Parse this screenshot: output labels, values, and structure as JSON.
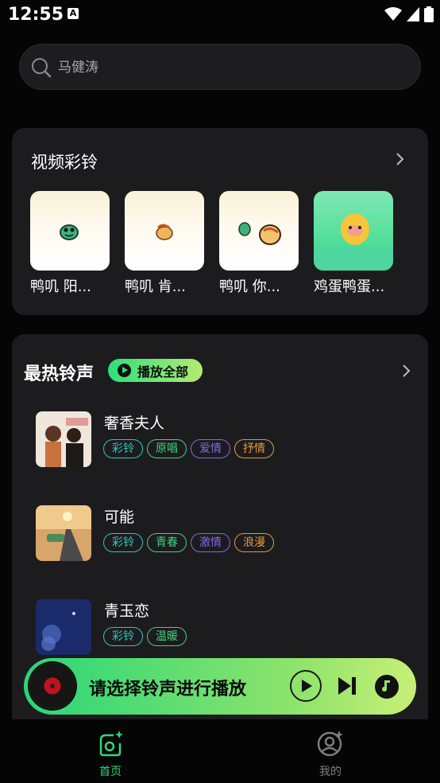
{
  "status_bar": {
    "time": "12:55",
    "notif_icon": "A"
  },
  "search": {
    "placeholder": "马健涛"
  },
  "video_section": {
    "title": "视频彩铃",
    "items": [
      {
        "caption": "鸭叽 阳..."
      },
      {
        "caption": "鸭叽 肯..."
      },
      {
        "caption": "鸭叽 你..."
      },
      {
        "caption": "鸡蛋鸭蛋..."
      }
    ]
  },
  "hot_section": {
    "title": "最热铃声",
    "play_all": "播放全部",
    "songs": [
      {
        "name": "奢香夫人",
        "tags": [
          "彩铃",
          "原唱",
          "爱情",
          "抒情"
        ]
      },
      {
        "name": "可能",
        "tags": [
          "彩铃",
          "青春",
          "激情",
          "浪漫"
        ]
      },
      {
        "name": "青玉恋",
        "tags": [
          "彩铃",
          "温暖"
        ]
      }
    ]
  },
  "player": {
    "label": "请选择铃声进行播放"
  },
  "tabs": {
    "home": "首页",
    "mine": "我的"
  },
  "colors": {
    "accent_green": "#2fd77c",
    "tag_cyan": "#2fc7b8",
    "tag_green": "#42d27a",
    "tag_purple": "#8a63e8",
    "tag_orange": "#e79a3a"
  }
}
